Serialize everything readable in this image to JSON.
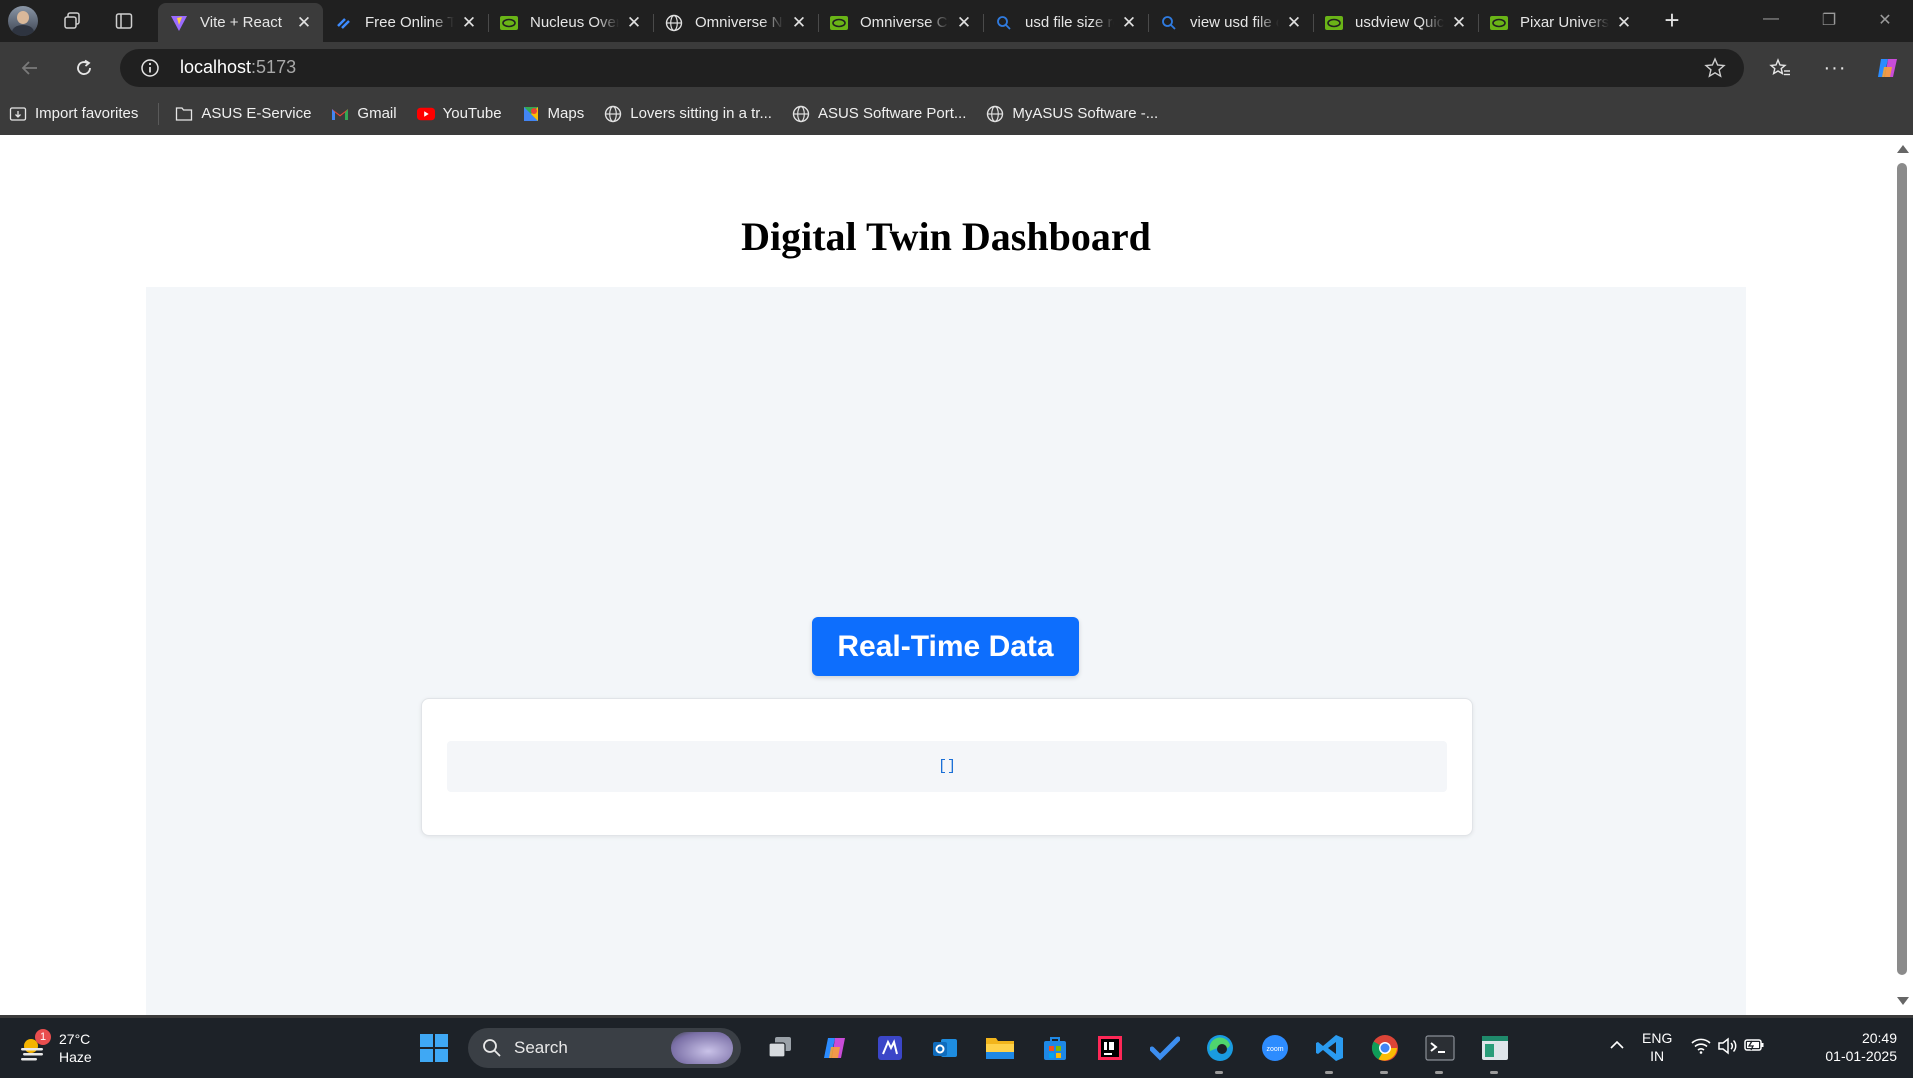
{
  "browser": {
    "tabs": [
      {
        "title": "Vite + React",
        "icon": "vite-icon",
        "active": true
      },
      {
        "title": "Free Online Tools",
        "icon": "tool-icon",
        "active": false
      },
      {
        "title": "Nucleus Overview",
        "icon": "nvidia-icon",
        "active": false
      },
      {
        "title": "Omniverse Nucleus",
        "icon": "globe-icon",
        "active": false
      },
      {
        "title": "Omniverse Client",
        "icon": "nvidia-icon",
        "active": false
      },
      {
        "title": "usd file size reduce",
        "icon": "search-icon",
        "active": false
      },
      {
        "title": "view usd file online",
        "icon": "search-icon",
        "active": false
      },
      {
        "title": "usdview Quickstart",
        "icon": "nvidia-icon",
        "active": false
      },
      {
        "title": "Pixar Universal Scene",
        "icon": "nvidia-icon",
        "active": false
      }
    ],
    "address": {
      "host": "localhost",
      "port": ":5173"
    },
    "bookmarks": [
      {
        "label": "Import favorites",
        "icon": "import-icon"
      },
      {
        "label": "ASUS E-Service",
        "icon": "folder-icon"
      },
      {
        "label": "Gmail",
        "icon": "gmail-icon"
      },
      {
        "label": "YouTube",
        "icon": "youtube-icon"
      },
      {
        "label": "Maps",
        "icon": "maps-icon"
      },
      {
        "label": "Lovers sitting in a tr...",
        "icon": "globe-icon"
      },
      {
        "label": "ASUS Software Port...",
        "icon": "globe-icon"
      },
      {
        "label": "MyASUS Software -...",
        "icon": "globe-icon"
      }
    ]
  },
  "page": {
    "title": "Digital Twin Dashboard",
    "button_label": "Real-Time Data",
    "data_output": "[]",
    "colors": {
      "accent": "#0d6efd",
      "panel_bg": "#f3f6f9",
      "code_text": "#1a6fd6"
    }
  },
  "taskbar": {
    "weather": {
      "temp": "27°C",
      "condition": "Haze",
      "badge": "1"
    },
    "search_label": "Search",
    "tray": {
      "lang_line1": "ENG",
      "lang_line2": "IN",
      "time": "20:49",
      "date": "01-01-2025"
    },
    "apps": [
      "task-view-icon",
      "copilot-icon",
      "visual-studio-icon",
      "outlook-icon",
      "file-explorer-icon",
      "store-icon",
      "intellij-icon",
      "todo-icon",
      "edge-icon",
      "zoom-icon",
      "vscode-icon",
      "chrome-icon",
      "terminal-icon",
      "app-icon"
    ]
  }
}
